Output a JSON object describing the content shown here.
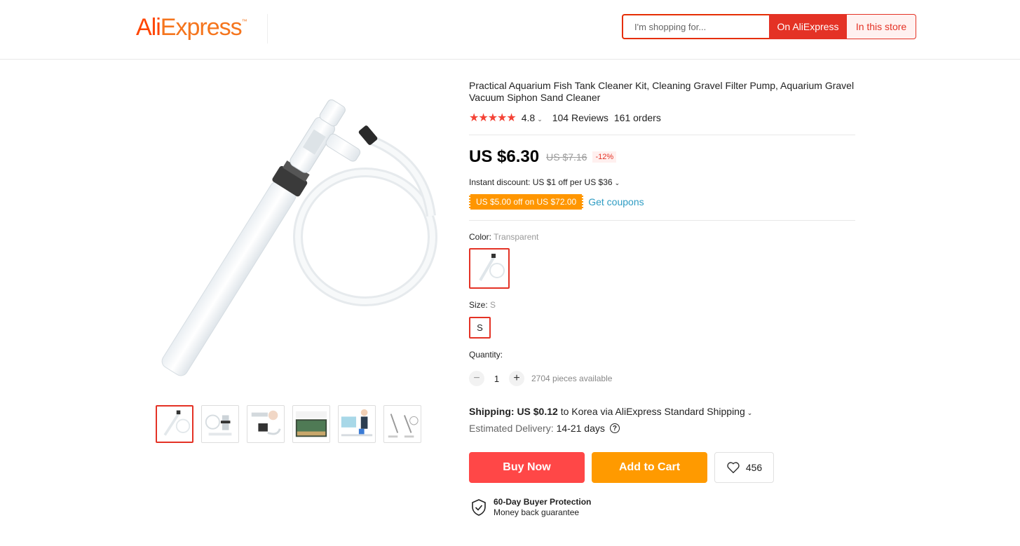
{
  "header": {
    "logo_ali": "Ali",
    "logo_express": "Express",
    "logo_tm": "™",
    "search_placeholder": "I'm shopping for...",
    "on_aliexpress_label": "On AliExpress",
    "in_this_store_label": "In this store"
  },
  "product": {
    "title": "Practical Aquarium Fish Tank Cleaner Kit, Cleaning Gravel Filter Pump, Aquarium Gravel Vacuum Siphon Sand Cleaner",
    "stars": "★★★★★",
    "rating": "4.8",
    "reviews": "104 Reviews",
    "orders": "161 orders",
    "price": "US $6.30",
    "old_price": "US $7.16",
    "discount": "-12%",
    "instant_discount": "Instant discount: US $1 off per US $36",
    "coupon": "US $5.00 off on US $72.00",
    "get_coupons": "Get coupons",
    "color_label": "Color:",
    "color_value": "Transparent",
    "size_label": "Size:",
    "size_value": "S",
    "size_option": "S",
    "quantity_label": "Quantity:",
    "quantity_minus": "−",
    "quantity": "1",
    "quantity_plus": "+",
    "quantity_available": "2704 pieces available",
    "shipping_label": "Shipping:",
    "shipping_price": "US $0.12",
    "shipping_dest": "to Korea via AliExpress Standard Shipping",
    "delivery_label": "Estimated Delivery:",
    "delivery_days": "14-21 days",
    "help_icon": "?",
    "buy_now": "Buy Now",
    "add_to_cart": "Add to Cart",
    "wishlist_count": "456",
    "protection_title": "60-Day Buyer Protection",
    "protection_sub": "Money back guarantee"
  },
  "icons": {
    "chevron": "chevron-down-icon",
    "heart": "heart-icon",
    "shield": "shield-check-icon",
    "help": "question-icon"
  },
  "colors": {
    "brand_red": "#e43225",
    "buy_now": "#ff4747",
    "add_to_cart": "#ff9a00",
    "coupon": "#ff9600",
    "link": "#2e9cc3",
    "stars": "#f44336"
  }
}
